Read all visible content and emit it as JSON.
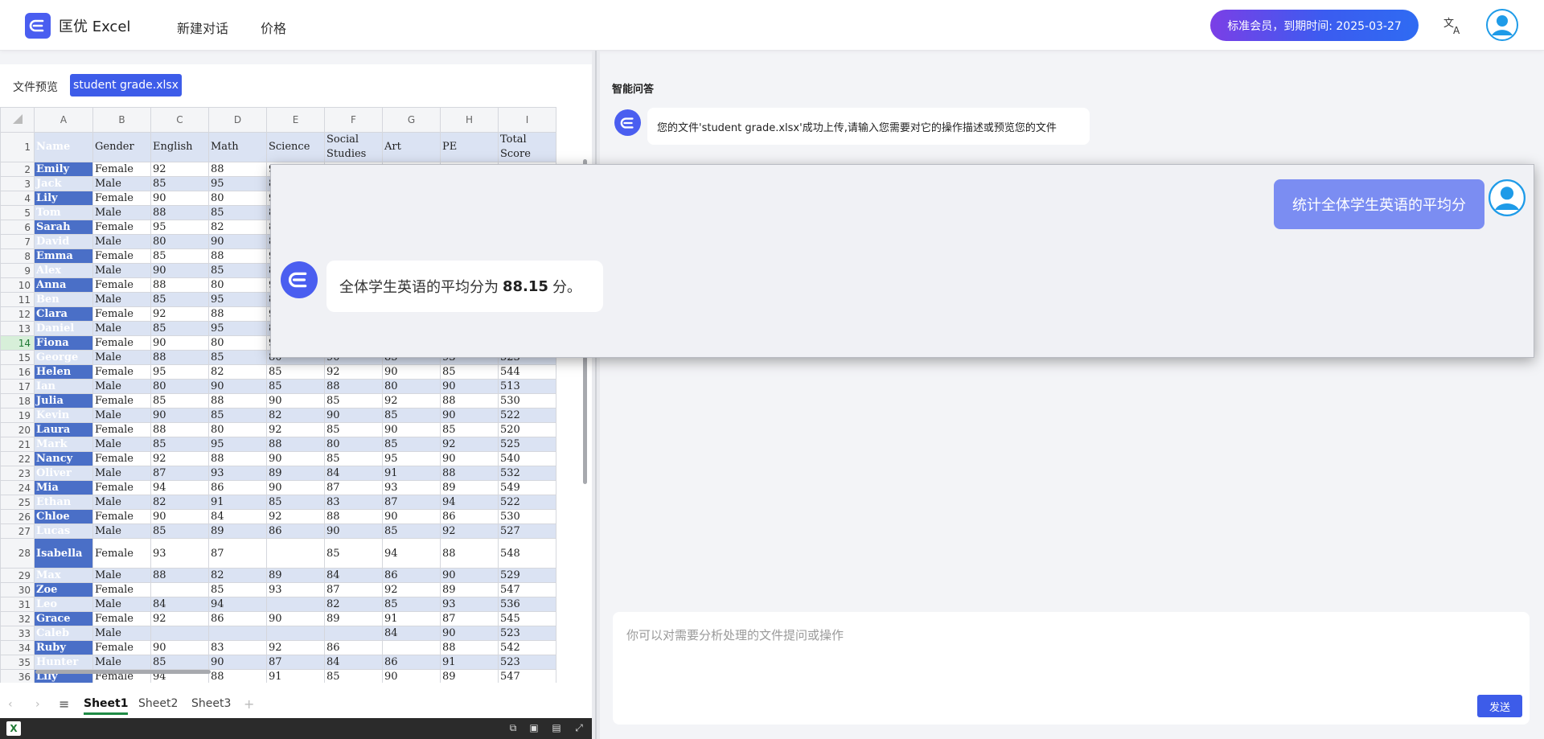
{
  "header": {
    "brand": "匡优 Excel",
    "nav": [
      "新建对话",
      "价格"
    ],
    "member_badge": "标准会员，到期时间: 2025-03-27",
    "brand_color": "#4a5ef0"
  },
  "preview": {
    "label": "文件预览",
    "file_name": "student grade.xlsx"
  },
  "sheet": {
    "columns": [
      "A",
      "B",
      "C",
      "D",
      "E",
      "F",
      "G",
      "H",
      "I"
    ],
    "header_row": [
      "Name",
      "Gender",
      "English",
      "Math",
      "Science",
      "Social Studies",
      "Art",
      "PE",
      "Total Score"
    ],
    "rows": [
      [
        "Emily",
        "Female",
        "92",
        "88",
        "9",
        "",
        "",
        "",
        ""
      ],
      [
        "Jack",
        "Male",
        "85",
        "95",
        "8",
        "",
        "",
        "",
        ""
      ],
      [
        "Lily",
        "Female",
        "90",
        "80",
        "9",
        "",
        "",
        "",
        ""
      ],
      [
        "Tom",
        "Male",
        "88",
        "85",
        "8",
        "",
        "",
        "",
        ""
      ],
      [
        "Sarah",
        "Female",
        "95",
        "82",
        "8",
        "",
        "",
        "",
        ""
      ],
      [
        "David",
        "Male",
        "80",
        "90",
        "8",
        "",
        "",
        "",
        ""
      ],
      [
        "Emma",
        "Female",
        "85",
        "88",
        "9",
        "",
        "",
        "",
        ""
      ],
      [
        "Alex",
        "Male",
        "90",
        "85",
        "8",
        "",
        "",
        "",
        ""
      ],
      [
        "Anna",
        "Female",
        "88",
        "80",
        "9",
        "",
        "",
        "",
        ""
      ],
      [
        "Ben",
        "Male",
        "85",
        "95",
        "8",
        "",
        "",
        "",
        ""
      ],
      [
        "Clara",
        "Female",
        "92",
        "88",
        "9",
        "",
        "",
        "",
        ""
      ],
      [
        "Daniel",
        "Male",
        "85",
        "95",
        "8",
        "",
        "",
        "",
        ""
      ],
      [
        "Fiona",
        "Female",
        "90",
        "80",
        "9",
        "",
        "",
        "",
        ""
      ],
      [
        "George",
        "Male",
        "88",
        "85",
        "80",
        "90",
        "85",
        "93",
        "523"
      ],
      [
        "Helen",
        "Female",
        "95",
        "82",
        "85",
        "92",
        "90",
        "85",
        "544"
      ],
      [
        "Ian",
        "Male",
        "80",
        "90",
        "85",
        "88",
        "80",
        "90",
        "513"
      ],
      [
        "Julia",
        "Female",
        "85",
        "88",
        "90",
        "85",
        "92",
        "88",
        "530"
      ],
      [
        "Kevin",
        "Male",
        "90",
        "85",
        "82",
        "90",
        "85",
        "90",
        "522"
      ],
      [
        "Laura",
        "Female",
        "88",
        "80",
        "92",
        "85",
        "90",
        "85",
        "520"
      ],
      [
        "Mark",
        "Male",
        "85",
        "95",
        "88",
        "80",
        "85",
        "92",
        "525"
      ],
      [
        "Nancy",
        "Female",
        "92",
        "88",
        "90",
        "85",
        "95",
        "90",
        "540"
      ],
      [
        "Oliver",
        "Male",
        "87",
        "93",
        "89",
        "84",
        "91",
        "88",
        "532"
      ],
      [
        "Mia",
        "Female",
        "94",
        "86",
        "90",
        "87",
        "93",
        "89",
        "549"
      ],
      [
        "Ethan",
        "Male",
        "82",
        "91",
        "85",
        "83",
        "87",
        "94",
        "522"
      ],
      [
        "Chloe",
        "Female",
        "90",
        "84",
        "92",
        "88",
        "90",
        "86",
        "530"
      ],
      [
        "Lucas",
        "Male",
        "85",
        "89",
        "86",
        "90",
        "85",
        "92",
        "527"
      ],
      [
        "Isabella",
        "Female",
        "93",
        "87",
        "",
        "85",
        "94",
        "88",
        "548"
      ],
      [
        "Max",
        "Male",
        "88",
        "82",
        "89",
        "84",
        "86",
        "90",
        "529"
      ],
      [
        "Zoe",
        "Female",
        "",
        "85",
        "93",
        "87",
        "92",
        "89",
        "547"
      ],
      [
        "Leo",
        "Male",
        "84",
        "94",
        "",
        "82",
        "85",
        "93",
        "536"
      ],
      [
        "Grace",
        "Female",
        "92",
        "86",
        "90",
        "89",
        "91",
        "87",
        "545"
      ],
      [
        "Caleb",
        "Male",
        "",
        "",
        "",
        "",
        "84",
        "90",
        "523"
      ],
      [
        "Ruby",
        "Female",
        "90",
        "83",
        "92",
        "86",
        "",
        "88",
        "542"
      ],
      [
        "Hunter",
        "Male",
        "85",
        "90",
        "87",
        "84",
        "86",
        "91",
        "523"
      ],
      [
        "Lily",
        "Female",
        "94",
        "88",
        "91",
        "85",
        "90",
        "89",
        "547"
      ]
    ],
    "active_row": 14,
    "tabs": [
      "Sheet1",
      "Sheet2",
      "Sheet3"
    ],
    "active_tab": "Sheet1"
  },
  "qa": {
    "title": "智能问答",
    "upload_message": "您的文件'student grade.xlsx'成功上传,请输入您需要对它的操作描述或预览您的文件",
    "user_question": "统计全体学生英语的平均分",
    "answer_prefix": "全体学生英语的平均分为",
    "answer_value": "88.15",
    "answer_suffix": "分。",
    "input_placeholder": "你可以对需要分析处理的文件提问或操作",
    "send_label": "发送"
  }
}
